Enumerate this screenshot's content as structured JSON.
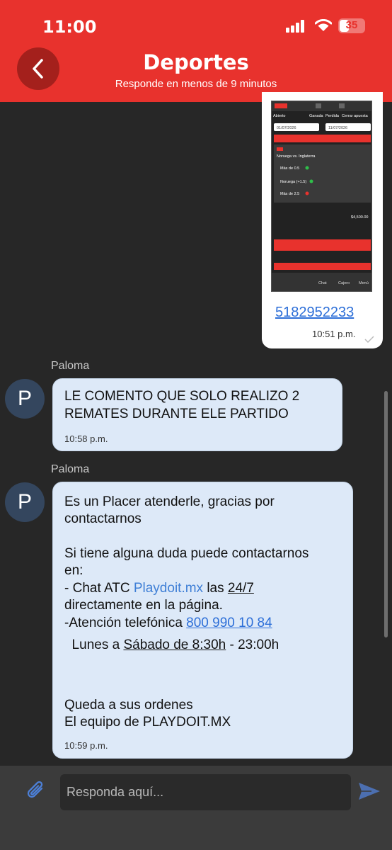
{
  "status_bar": {
    "time": "11:00",
    "battery": "35"
  },
  "header": {
    "title": "Deportes",
    "subtitle": "Responde en menos de 9 minutos"
  },
  "sent_message": {
    "link": "5182952233",
    "time": "10:51 p.m.",
    "attachment": {
      "tabs": [
        "Abierto",
        "Ganada",
        "Perdida",
        "Cerrar apuesta"
      ],
      "date_from": "01/07/2026",
      "date_to": "11/07/2026",
      "match": "Noruega vs. Inglaterra",
      "lines": [
        "Más de 0.5",
        "Noruega (+1.5)",
        "Más de 2.5"
      ],
      "amount": "$4,500.00",
      "bottom_nav": [
        "Chat",
        "Cajero",
        "Menú"
      ]
    }
  },
  "messages": [
    {
      "sender": "Paloma",
      "avatar": "P",
      "text": "LE COMENTO QUE SOLO REALIZO 2\nREMATES DURANTE ELE PARTIDO",
      "time": "10:58 p.m."
    },
    {
      "sender": "Paloma",
      "avatar": "P",
      "lines": {
        "l1": "Es un Placer atenderle, gracias por",
        "l2": "contactarnos",
        "l3": "Si tiene alguna duda puede contactarnos",
        "l4": "en:",
        "l5_prefix": "- Chat ATC ",
        "l5_link": "Playdoit.mx",
        "l5_mid": " las ",
        "l5_hours": "24/7",
        "l6": "directamente en la página.",
        "l7_prefix": "-Atención telefónica ",
        "l7_phone": "800 990 10 84",
        "l8_prefix": "  Lunes a ",
        "l8_days": "Sábado de 8:30h",
        "l8_suffix": " - 23:00h",
        "l9": "Queda a sus ordenes",
        "l10": "El equipo de PLAYDOIT.MX"
      },
      "time": "10:59 p.m."
    }
  ],
  "composer": {
    "placeholder": "Responda aquí..."
  },
  "colors": {
    "brand_red": "#e8322d",
    "bubble_blue": "#dde9f8",
    "background": "#272727"
  }
}
